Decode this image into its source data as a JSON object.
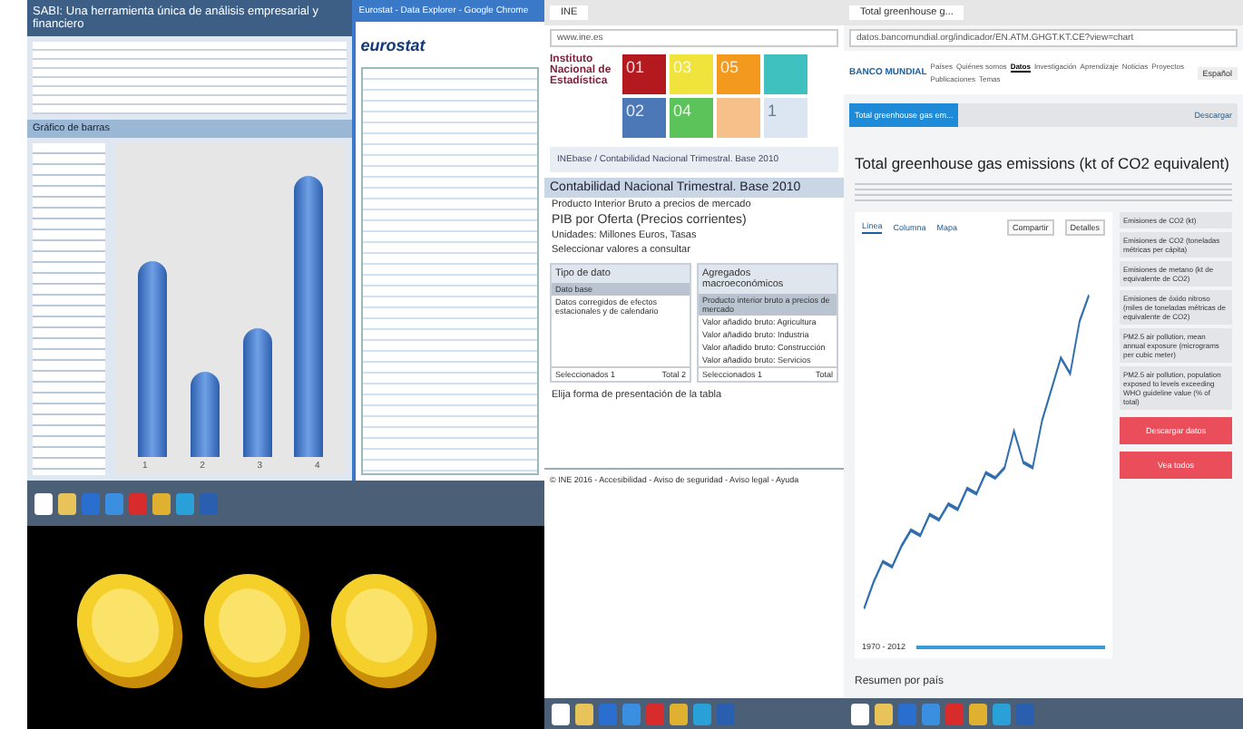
{
  "sabi_window": {
    "title": "SABI: Una herramienta única de análisis empresarial y financiero",
    "section": "Gráfico de barras",
    "bar_labels": [
      "1",
      "2",
      "3",
      "4"
    ]
  },
  "eurostat_window": {
    "title": "Eurostat - Data Explorer - Google Chrome",
    "logo": "eurostat"
  },
  "ine_window": {
    "tab": "INE",
    "url": "www.ine.es",
    "org": "Instituto Nacional de Estadística",
    "tiles": [
      {
        "number": "01",
        "color": "#b3191e"
      },
      {
        "number": "03",
        "color": "#efe33c"
      },
      {
        "number": "05",
        "color": "#f39a1e"
      },
      {
        "color": "#3fc1c0"
      },
      {
        "number": "02",
        "color": "#4d78b8"
      },
      {
        "number": "04",
        "color": "#5cc25a"
      },
      {
        "color": "#f6c08a"
      },
      {
        "number": "1",
        "color": "#dbe6f2"
      }
    ],
    "breadcrumb": "INEbase / Contabilidad Nacional Trimestral. Base 2010",
    "heading": "Contabilidad Nacional Trimestral. Base 2010",
    "subtitle": "Producto Interior Bruto a precios de mercado",
    "table_title": "PIB por Oferta (Precios corrientes)",
    "units": "Unidades: Millones Euros, Tasas",
    "select_label": "Seleccionar valores a consultar",
    "panels": [
      {
        "title": "Tipo de dato",
        "items": [
          {
            "label": "Dato base",
            "selected": true
          },
          {
            "label": "Datos corregidos de efectos estacionales y de calendario",
            "selected": false
          }
        ],
        "footer_left": "Seleccionados 1",
        "footer_right": "Total 2"
      },
      {
        "title": "Agregados macroeconómicos",
        "items": [
          {
            "label": "Producto interior bruto a precios de mercado",
            "selected": true
          },
          {
            "label": "Valor añadido bruto: Agricultura",
            "selected": false
          },
          {
            "label": "Valor añadido bruto: Industria",
            "selected": false
          },
          {
            "label": "Valor añadido bruto: Construcción",
            "selected": false
          },
          {
            "label": "Valor añadido bruto: Servicios",
            "selected": false
          }
        ],
        "footer_left": "Seleccionados 1",
        "footer_right": "Total"
      }
    ],
    "presentation_label": "Elija forma de presentación de la tabla",
    "footer": "© INE 2016 - Accesibilidad - Aviso de seguridad - Aviso legal - Ayuda"
  },
  "worldbank_window": {
    "tab": "Total greenhouse g...",
    "url": "datos.bancomundial.org/indicador/EN.ATM.GHGT.KT.CE?view=chart",
    "logo": "BANCO MUNDIAL",
    "nav": [
      {
        "label": "Países",
        "selected": false
      },
      {
        "label": "Quiénes somos",
        "selected": false
      },
      {
        "label": "Datos",
        "selected": true
      },
      {
        "label": "Investigación",
        "selected": false
      },
      {
        "label": "Aprendizaje",
        "selected": false
      },
      {
        "label": "Noticias",
        "selected": false
      },
      {
        "label": "Proyectos",
        "selected": false
      },
      {
        "label": "Publicaciones",
        "selected": false
      },
      {
        "label": "Temas",
        "selected": false
      }
    ],
    "language": "Español",
    "search_chip": "Total greenhouse gas em...",
    "download_link": "Descargar",
    "heading": "Total greenhouse gas emissions (kt of CO2 equivalent)",
    "chart_tabs": [
      {
        "label": "Línea",
        "selected": true
      },
      {
        "label": "Columna",
        "selected": false
      },
      {
        "label": "Mapa",
        "selected": false
      }
    ],
    "chart_buttons": [
      "Compartir",
      "Detalles"
    ],
    "related": [
      "Emisiones de CO2 (kt)",
      "Emisiones de CO2 (toneladas métricas per cápita)",
      "Emisiones de metano (kt de equivalente de CO2)",
      "Emisiones de óxido nitroso (miles de toneladas métricas de equivalente de CO2)",
      "PM2.5 air pollution, mean annual exposure (micrograms per cubic meter)",
      "PM2.5 air pollution, population exposed to levels exceeding WHO guideline value (% of total)"
    ],
    "action_buttons": [
      "Descargar datos",
      "Vea todos"
    ],
    "range": {
      "label": "1970 - 2012",
      "level": 1
    },
    "summary_heading": "Resumen por país"
  }
}
